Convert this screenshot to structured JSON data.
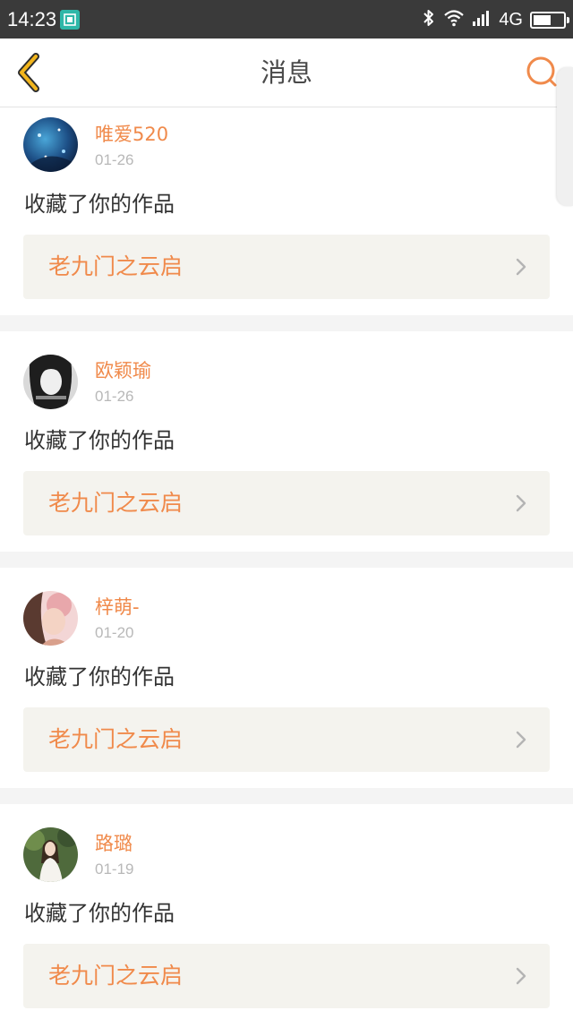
{
  "status_bar": {
    "time": "14:23",
    "network": "4G",
    "battery_level": 0.6,
    "icons": [
      "screenshot-app-icon",
      "bluetooth-icon",
      "wifi-icon",
      "signal-icon",
      "battery-icon"
    ]
  },
  "header": {
    "title": "消息",
    "back_icon": "chevron-left-icon",
    "search_icon": "search-icon"
  },
  "colors": {
    "accent": "#f08a4b",
    "back_icon": "#f2b51c",
    "status_bar_bg": "#3a3a3a",
    "work_link_bg": "#f4f3ee"
  },
  "messages": [
    {
      "user": "唯爱520",
      "date": "01-26",
      "action": "收藏了你的作品",
      "work_title": "老九门之云启",
      "avatar": "night-sky-avatar"
    },
    {
      "user": "欧颖瑜",
      "date": "01-26",
      "action": "收藏了你的作品",
      "work_title": "老九门之云启",
      "avatar": "monochrome-girl-avatar"
    },
    {
      "user": "梓萌-",
      "date": "01-20",
      "action": "收藏了你的作品",
      "work_title": "老九门之云启",
      "avatar": "pink-portrait-avatar"
    },
    {
      "user": "路璐",
      "date": "01-19",
      "action": "收藏了你的作品",
      "work_title": "老九门之云启",
      "avatar": "outdoor-girl-avatar"
    }
  ]
}
